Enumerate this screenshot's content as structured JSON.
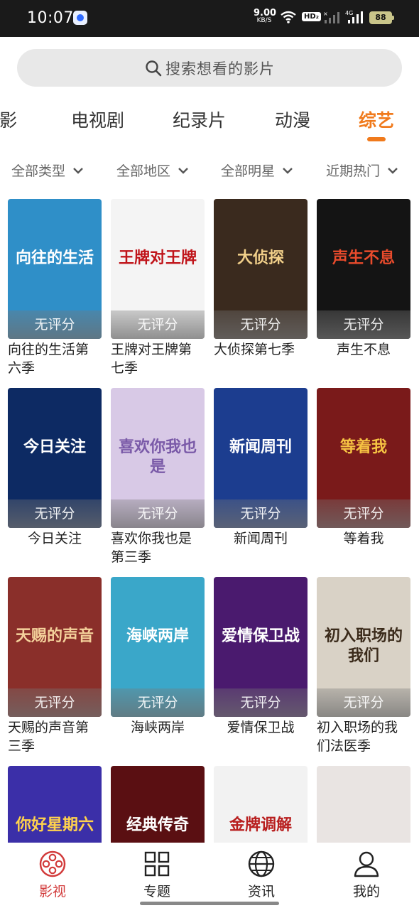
{
  "status_bar": {
    "time": "10:07",
    "net_speed_value": "9.00",
    "net_speed_unit": "KB/S",
    "hd_label": "HD₂",
    "battery": "88"
  },
  "search": {
    "placeholder": "搜索想看的影片",
    "icon": "search-icon"
  },
  "category_tabs": {
    "items": [
      {
        "label": "电影"
      },
      {
        "label": "电视剧"
      },
      {
        "label": "纪录片"
      },
      {
        "label": "动漫"
      },
      {
        "label": "综艺",
        "active": true
      }
    ],
    "accent_color": "#f07a1c"
  },
  "filters": [
    {
      "label": "全部类型"
    },
    {
      "label": "全部地区"
    },
    {
      "label": "全部明星"
    },
    {
      "label": "近期热门"
    }
  ],
  "rating_placeholder": "无评分",
  "shows": [
    {
      "title": "向往的生活第六季",
      "poster_text": "向往的生活",
      "bg": "#2f8fc8"
    },
    {
      "title": "王牌对王牌第七季",
      "poster_text": "王牌对王牌",
      "bg": "#f4f4f4"
    },
    {
      "title": "大侦探第七季",
      "poster_text": "大侦探",
      "bg": "#3a2a1e"
    },
    {
      "title": "声生不息",
      "poster_text": "声生不息",
      "bg": "#141414"
    },
    {
      "title": "今日关注",
      "poster_text": "今日关注",
      "bg": "#0d2a63"
    },
    {
      "title": "喜欢你我也是第三季",
      "poster_text": "喜欢你我也是",
      "bg": "#d8c9e6"
    },
    {
      "title": "新闻周刊",
      "poster_text": "新闻周刊",
      "bg": "#1c3d8f"
    },
    {
      "title": "等着我",
      "poster_text": "等着我",
      "bg": "#7a1a1a"
    },
    {
      "title": "天赐的声音第三季",
      "poster_text": "天赐的声音",
      "bg": "#8a2f2a"
    },
    {
      "title": "海峡两岸",
      "poster_text": "海峡两岸",
      "bg": "#3aa7c9"
    },
    {
      "title": "爱情保卫战",
      "poster_text": "爱情保卫战",
      "bg": "#4a1a6e"
    },
    {
      "title": "初入职场的我们法医季",
      "poster_text": "初入职场的我们",
      "bg": "#d9d2c6"
    },
    {
      "title": "",
      "poster_text": "你好星期六",
      "bg": "#3b2fa8"
    },
    {
      "title": "",
      "poster_text": "经典传奇",
      "bg": "#5a0f12"
    },
    {
      "title": "",
      "poster_text": "金牌调解",
      "bg": "#f2f2f2"
    },
    {
      "title": "",
      "poster_text": "",
      "bg": "#e9e4e2"
    }
  ],
  "bottom_nav": [
    {
      "label": "影视",
      "icon": "film-reel-icon",
      "active": true
    },
    {
      "label": "专题",
      "icon": "grid-icon"
    },
    {
      "label": "资讯",
      "icon": "globe-icon"
    },
    {
      "label": "我的",
      "icon": "user-icon"
    }
  ],
  "active_nav_color": "#d23b3b"
}
